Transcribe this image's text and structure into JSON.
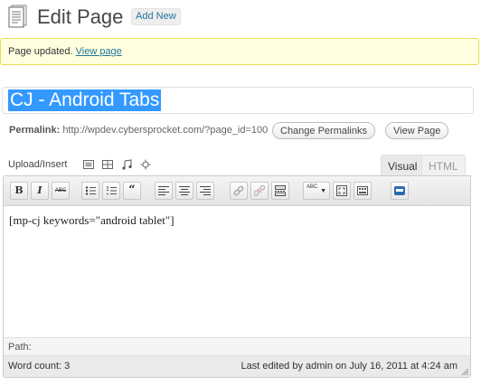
{
  "header": {
    "title": "Edit Page",
    "add_new": "Add New",
    "icon": "page-icon"
  },
  "notice": {
    "text": "Page updated. ",
    "link": "View page"
  },
  "post": {
    "title": "CJ - Android Tabs",
    "permalink_label": "Permalink:",
    "permalink_url": "http://wpdev.cybersprocket.com/?page_id=100",
    "change_permalinks": "Change Permalinks",
    "view_page": "View Page"
  },
  "upload": {
    "label": "Upload/Insert",
    "icons": [
      "image-icon",
      "video-icon",
      "audio-icon",
      "media-icon"
    ]
  },
  "editor": {
    "tabs": {
      "visual": "Visual",
      "html": "HTML"
    },
    "toolbar": [
      {
        "name": "bold-button",
        "label": "B"
      },
      {
        "name": "italic-button",
        "label": "I"
      },
      {
        "name": "strikethrough-button",
        "label": "ABC"
      },
      {
        "name": "bullet-list-button",
        "icon": "bullet-list-icon"
      },
      {
        "name": "numbered-list-button",
        "icon": "numbered-list-icon"
      },
      {
        "name": "blockquote-button",
        "label": "“"
      },
      {
        "name": "align-left-button",
        "icon": "align-left-icon"
      },
      {
        "name": "align-center-button",
        "icon": "align-center-icon"
      },
      {
        "name": "align-right-button",
        "icon": "align-right-icon"
      },
      {
        "name": "insert-link-button",
        "icon": "link-icon"
      },
      {
        "name": "unlink-button",
        "icon": "unlink-icon"
      },
      {
        "name": "insert-more-button",
        "icon": "more-tag-icon"
      },
      {
        "name": "spellcheck-button",
        "label": "ABC"
      },
      {
        "name": "fullscreen-button",
        "icon": "fullscreen-icon"
      },
      {
        "name": "kitchen-sink-button",
        "icon": "kitchen-sink-icon"
      },
      {
        "name": "plugin-button",
        "icon": "plugin-icon"
      }
    ],
    "content": "[mp-cj keywords=\"android tablet\"]",
    "path_label": "Path:",
    "word_count": "Word count: 3",
    "last_edited": "Last edited by admin on July 16, 2011 at 4:24 am"
  },
  "colors": {
    "link": "#21759b",
    "notice_bg": "#ffffe0",
    "notice_border": "#e6db55",
    "selection": "#3399ff"
  }
}
